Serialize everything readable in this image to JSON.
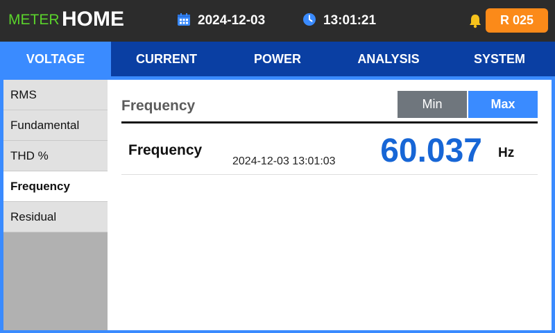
{
  "header": {
    "brand_meter": "METER",
    "brand_home": "HOME",
    "date": "2024-12-03",
    "time": "13:01:21",
    "date_icon": "calendar-icon",
    "time_icon": "clock-icon",
    "alarm_icon": "bell-icon",
    "badge": "R 025",
    "colors": {
      "bar": "#2c2c2c",
      "meter": "#5bd32b",
      "badge": "#fb8a19"
    }
  },
  "tabs": [
    {
      "label": "VOLTAGE",
      "active": true
    },
    {
      "label": "CURRENT",
      "active": false
    },
    {
      "label": "POWER",
      "active": false
    },
    {
      "label": "ANALYSIS",
      "active": false
    },
    {
      "label": "SYSTEM",
      "active": false
    }
  ],
  "sidebar": {
    "items": [
      {
        "label": "RMS",
        "active": false
      },
      {
        "label": "Fundamental",
        "active": false
      },
      {
        "label": "THD %",
        "active": false
      },
      {
        "label": "Frequency",
        "active": true
      },
      {
        "label": "Residual",
        "active": false
      }
    ]
  },
  "panel": {
    "title": "Frequency",
    "buttons": {
      "min": "Min",
      "max": "Max",
      "selected": "Max"
    },
    "row": {
      "label": "Frequency",
      "timestamp": "2024-12-03 13:01:03",
      "value": "60.037",
      "unit": "Hz"
    },
    "colors": {
      "accent": "#3a8bff",
      "value": "#1766d6",
      "tab_bar": "#0a3fa3"
    }
  }
}
